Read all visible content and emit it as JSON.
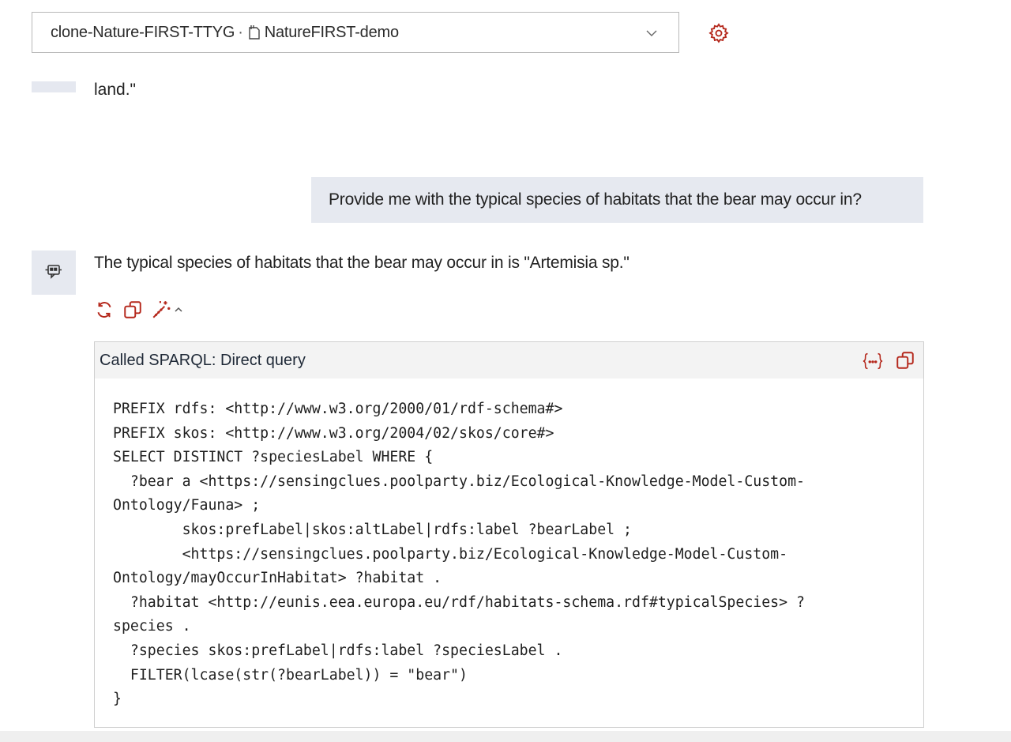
{
  "repo_selector": {
    "name": "clone-Nature-FIRST-TTYG",
    "separator": "·",
    "repository": "NatureFIRST-demo",
    "dropdown_icon": "chevron-down-icon"
  },
  "settings_icon": "gear-icon",
  "previous_message": {
    "text": "land.\""
  },
  "user_message": {
    "text": "Provide me with the typical species of habitats that the bear may occur in?"
  },
  "bot_message": {
    "text": "The typical species of habitats that the bear may occur in is \"Artemisia sp.\"",
    "actions": [
      "regenerate-icon",
      "copy-icon",
      "magic-wand-icon",
      "chevron-up-icon"
    ]
  },
  "tool_call": {
    "title": "Called SPARQL: Direct query",
    "code": "PREFIX rdfs: <http://www.w3.org/2000/01/rdf-schema#>\nPREFIX skos: <http://www.w3.org/2004/02/skos/core#>\nSELECT DISTINCT ?speciesLabel WHERE {\n  ?bear a <https://sensingclues.poolparty.biz/Ecological-Knowledge-Model-Custom-\nOntology/Fauna> ;\n        skos:prefLabel|skos:altLabel|rdfs:label ?bearLabel ;\n        <https://sensingclues.poolparty.biz/Ecological-Knowledge-Model-Custom-\nOntology/mayOccurInHabitat> ?habitat .\n  ?habitat <http://eunis.eea.europa.eu/rdf/habitats-schema.rdf#typicalSpecies> ?\nspecies .\n  ?species skos:prefLabel|rdfs:label ?speciesLabel .\n  FILTER(lcase(str(?bearLabel)) = \"bear\")\n}"
  },
  "colors": {
    "accent": "#b5281c",
    "bubble": "#e6e9f0",
    "header_bg": "#f3f3f3"
  }
}
